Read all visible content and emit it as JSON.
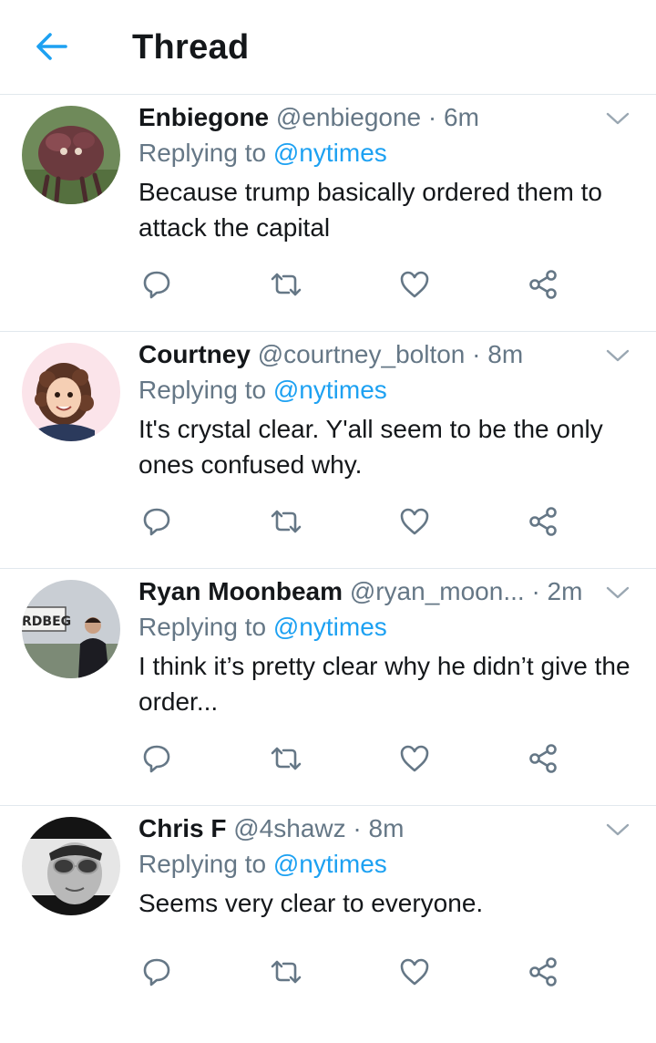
{
  "header": {
    "title": "Thread",
    "back_icon": "arrow-left-icon",
    "accent": "#1da1f2"
  },
  "colors": {
    "text": "#14171a",
    "secondary": "#657786",
    "link": "#1da1f2",
    "divider": "#e1e8ed",
    "icon": "#657786"
  },
  "tweets": [
    {
      "display_name": "Enbiegone",
      "handle": "@enbiegone",
      "separator": "·",
      "time": "6m",
      "replying_prefix": "Replying to",
      "replying_to": "@nytimes",
      "text": "Because trump basically ordered them to attack the capital",
      "avatar_icon": "creature-avatar"
    },
    {
      "display_name": "Courtney",
      "handle": "@courtney_bolton",
      "separator": "·",
      "time": "8m",
      "replying_prefix": "Replying to",
      "replying_to": "@nytimes",
      "text": "It's crystal clear. Y'all seem to be the only ones confused why.",
      "avatar_icon": "cartoon-avatar"
    },
    {
      "display_name": "Ryan Moonbeam",
      "handle": "@ryan_moon...",
      "separator": "·",
      "time": "2m",
      "replying_prefix": "Replying to",
      "replying_to": "@nytimes",
      "text": "I think it’s pretty clear why he didn’t give the order...",
      "avatar_icon": "photo-avatar",
      "avatar_sign_text": "RDBEG"
    },
    {
      "display_name": "Chris F",
      "handle": "@4shawz",
      "separator": "·",
      "time": "8m",
      "replying_prefix": "Replying to",
      "replying_to": "@nytimes",
      "text": "Seems very clear to everyone.",
      "avatar_icon": "sunglasses-avatar"
    }
  ],
  "action_icons": [
    "reply-icon",
    "retweet-icon",
    "like-icon",
    "share-icon"
  ]
}
